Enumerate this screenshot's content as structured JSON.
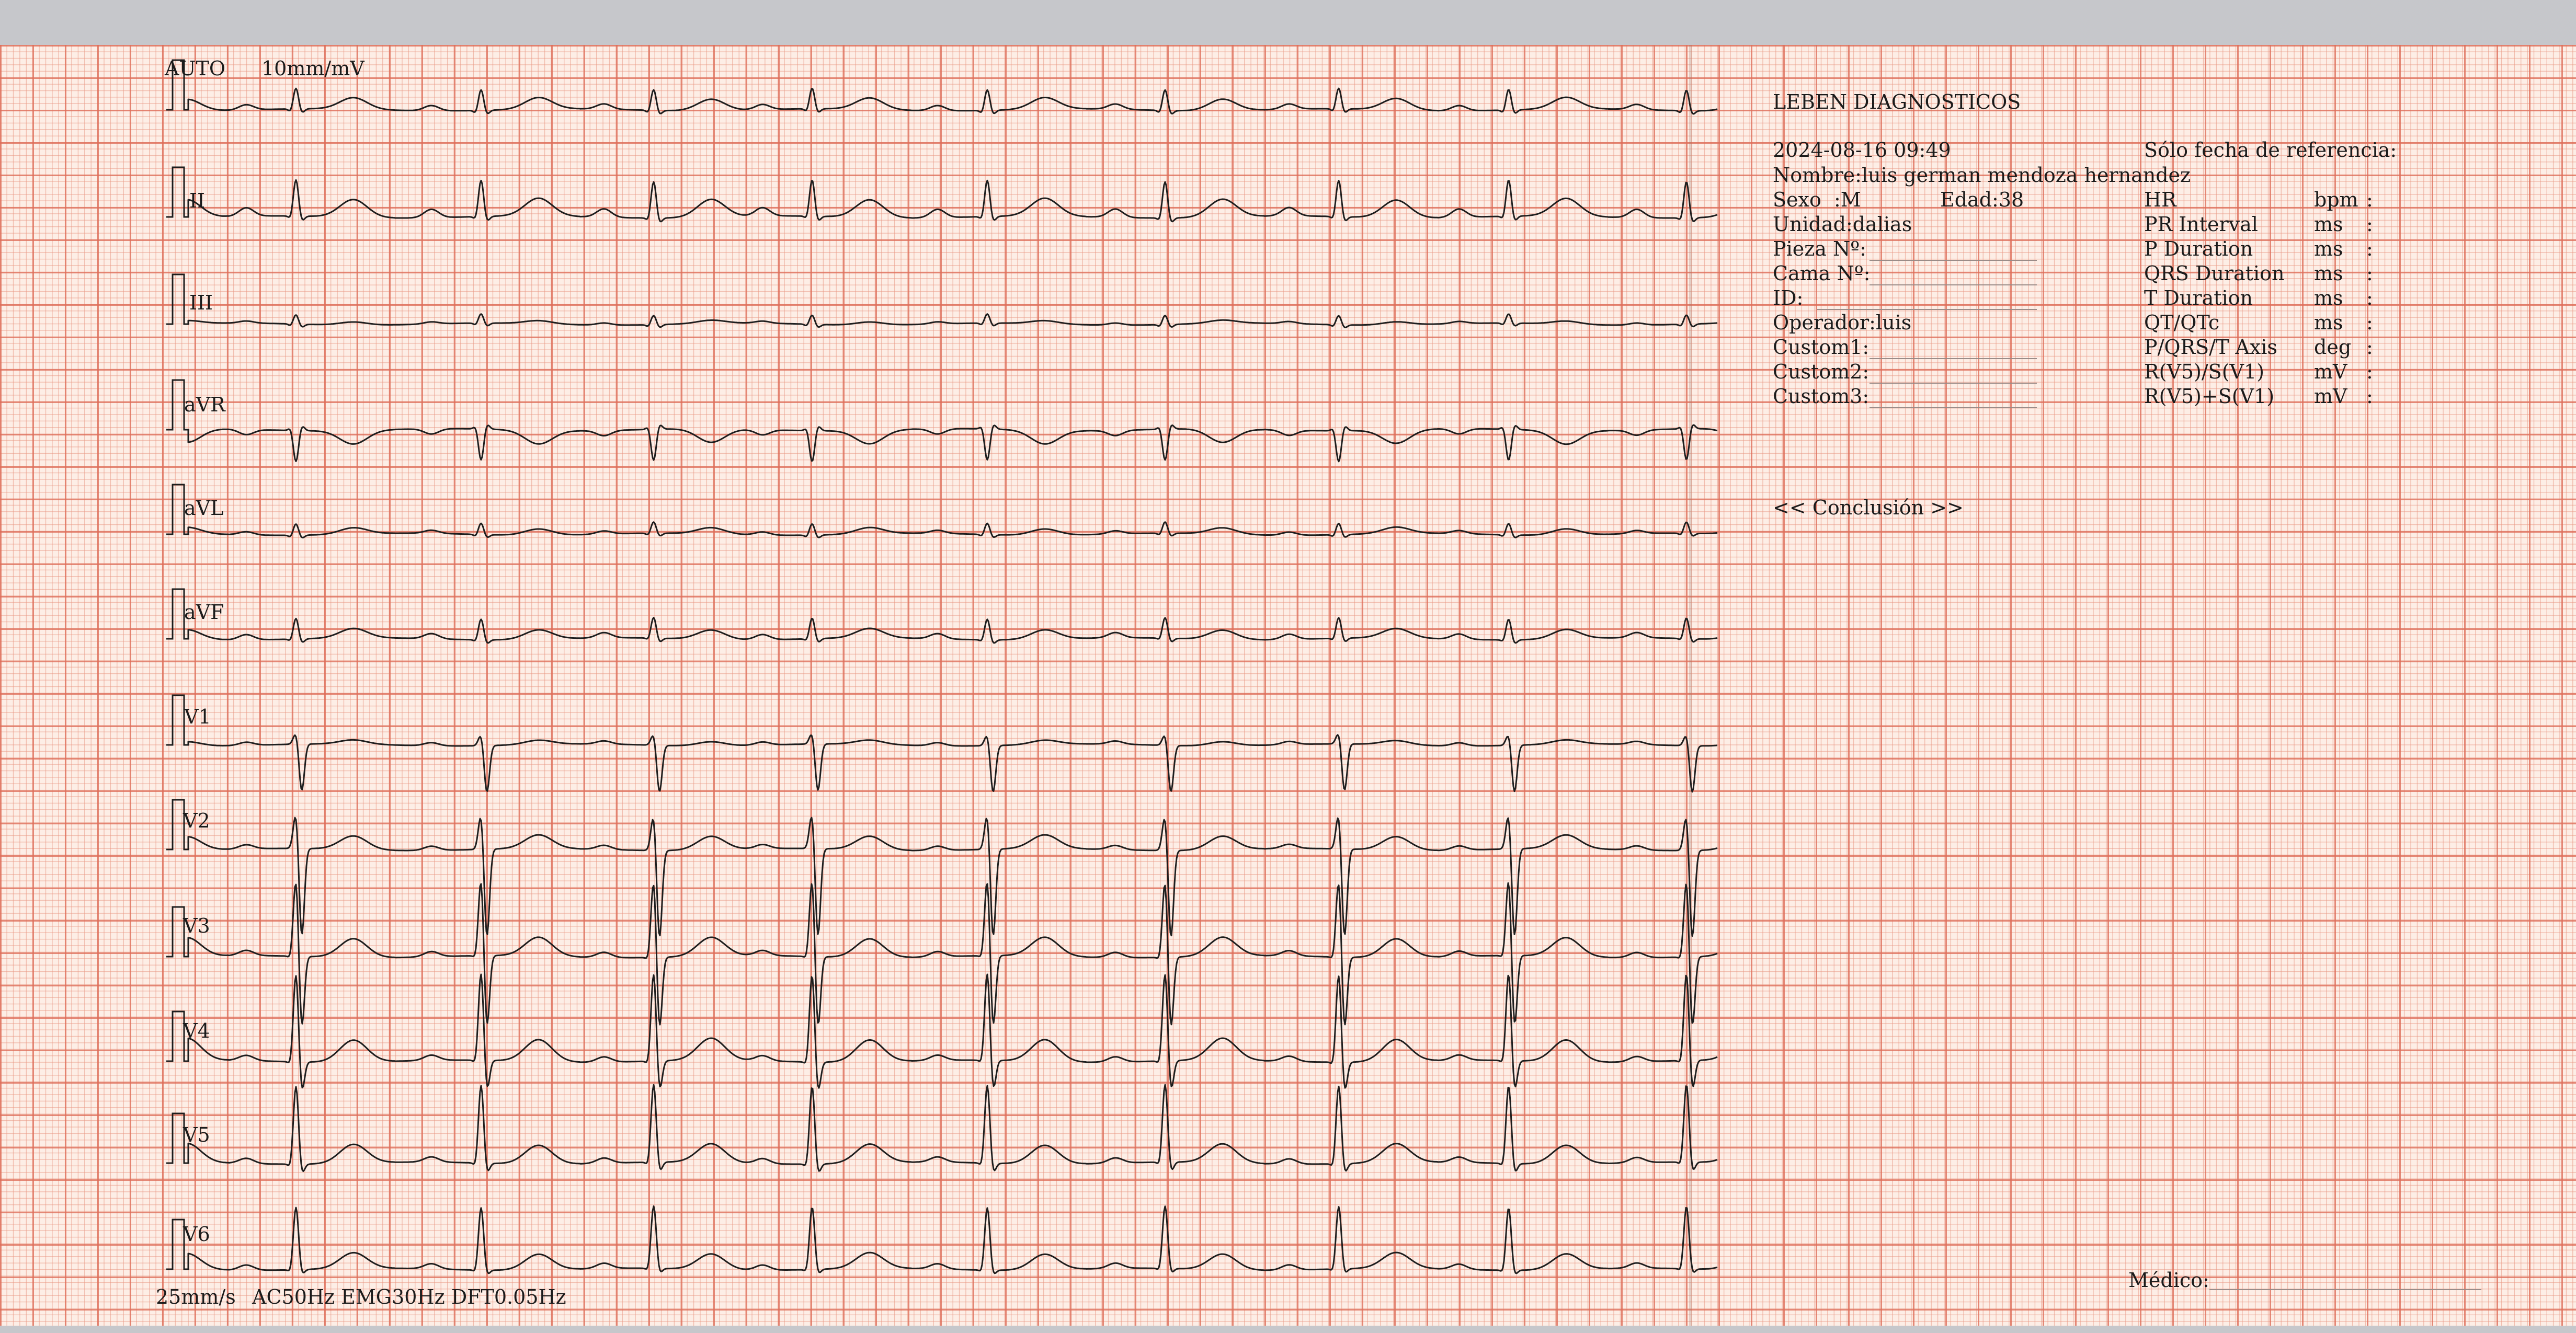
{
  "header": {
    "gain_mode": "AUTO",
    "gain": "10mm/mV",
    "paper_speed": "25mm/s",
    "filters": "AC50Hz EMG30Hz DFT0.05Hz"
  },
  "leads": [
    "I",
    "II",
    "III",
    "aVR",
    "aVL",
    "aVF",
    "V1",
    "V2",
    "V3",
    "V4",
    "V5",
    "V6"
  ],
  "report": {
    "institution": "LEBEN DIAGNOSTICOS",
    "datetime": "2024-08-16 09:49",
    "reference_note": "Sólo fecha de referencia:",
    "nombre": "Nombre:luis german mendoza hernandez",
    "sexo": "Sexo  :M",
    "edad": "Edad:38",
    "unidad": "Unidad:dalias",
    "pieza": "Pieza Nº:",
    "cama": "Cama Nº:",
    "id": "ID:",
    "operador": "Operador:luis",
    "custom1": "Custom1:",
    "custom2": "Custom2:",
    "custom3": "Custom3:",
    "measurements": [
      {
        "name": "HR",
        "unit": "bpm",
        "value": ":"
      },
      {
        "name": "PR Interval",
        "unit": "ms",
        "value": ":"
      },
      {
        "name": "P Duration",
        "unit": "ms",
        "value": ":"
      },
      {
        "name": "QRS Duration",
        "unit": "ms",
        "value": ":"
      },
      {
        "name": "T Duration",
        "unit": "ms",
        "value": ":"
      },
      {
        "name": "QT/QTc",
        "unit": "ms",
        "value": ":"
      },
      {
        "name": "P/QRS/T Axis",
        "unit": "deg",
        "value": ":"
      },
      {
        "name": "R(V5)/S(V1)",
        "unit": "mV",
        "value": ":"
      },
      {
        "name": "R(V5)+S(V1)",
        "unit": "mV",
        "value": ":"
      }
    ],
    "conclusion": "<< Conclusión >>",
    "medico": "Médico:"
  },
  "colors": {
    "paper": "#fdeee6",
    "grid_major": "#de6e5a",
    "grid_minor": "#e89682",
    "trace": "#1e1e1e",
    "background": "#c6c7cb"
  }
}
